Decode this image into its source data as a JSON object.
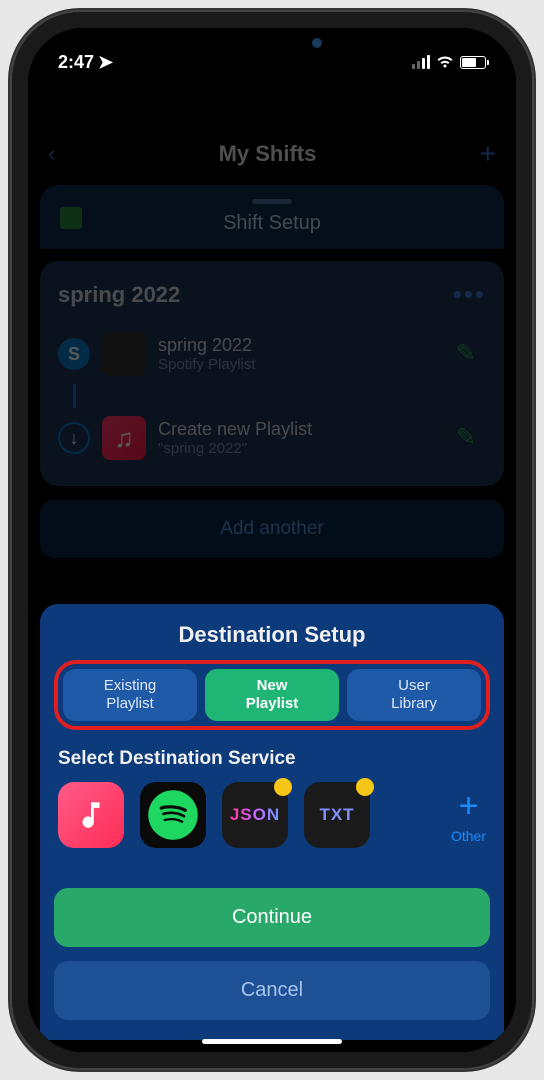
{
  "statusBar": {
    "time": "2:47",
    "locationArrow": "➤"
  },
  "background": {
    "headerTitle": "My Shifts",
    "sheetTitle": "Shift Setup",
    "card": {
      "title": "spring 2022",
      "sourceTitle": "spring 2022",
      "sourceSub": "Spotify Playlist",
      "destTitle": "Create new Playlist",
      "destSub": "\"spring 2022\""
    },
    "addAnother": "Add another"
  },
  "destSheet": {
    "title": "Destination Setup",
    "segments": {
      "existing": "Existing\nPlaylist",
      "new": "New\nPlaylist",
      "user": "User\nLibrary"
    },
    "selectLabel": "Select Destination Service",
    "services": {
      "json": "JSON",
      "txt": "TXT",
      "other": "Other"
    },
    "continueBtn": "Continue",
    "cancelBtn": "Cancel"
  }
}
